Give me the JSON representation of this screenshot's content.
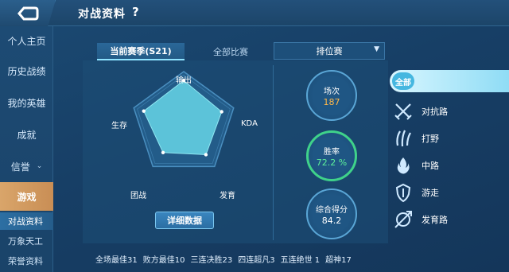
{
  "header": {
    "title": "对战资料",
    "help_glyph": "?"
  },
  "sidebar": {
    "items": [
      {
        "label": "个人主页"
      },
      {
        "label": "历史战绩"
      },
      {
        "label": "我的英雄"
      },
      {
        "label": "成就"
      },
      {
        "label": "信誉"
      },
      {
        "label": "游戏"
      }
    ],
    "sub_items": [
      {
        "label": "对战资料"
      },
      {
        "label": "万象天工"
      },
      {
        "label": "荣誉资料"
      }
    ]
  },
  "tabs": {
    "season": "当前赛季(S21)",
    "all": "全部比赛"
  },
  "mode_select": {
    "value": "排位赛"
  },
  "radar": {
    "axes": [
      "输出",
      "KDA",
      "发育",
      "团战",
      "生存"
    ],
    "values": [
      0.83,
      0.76,
      0.72,
      0.67,
      0.8
    ]
  },
  "detail_button": "详细数据",
  "stats": {
    "matches": {
      "label": "场次",
      "value": "187",
      "color": "#ffb84a"
    },
    "winrate": {
      "label": "胜率",
      "value": "72.2 %",
      "color": "#5df09a"
    },
    "score": {
      "label": "综合得分",
      "value": "84.2",
      "color": "#ffffff"
    }
  },
  "lanes": {
    "all_label": "全部",
    "items": [
      {
        "label": "对抗路",
        "icon": "crossed-swords-icon"
      },
      {
        "label": "打野",
        "icon": "claw-icon"
      },
      {
        "label": "中路",
        "icon": "mage-flame-icon"
      },
      {
        "label": "游走",
        "icon": "shield-wing-icon"
      },
      {
        "label": "发育路",
        "icon": "archer-icon"
      }
    ]
  },
  "footer": {
    "items": [
      "全场最佳31",
      "败方最佳10",
      "三连决胜23",
      "四连超凡3",
      "五连绝世 1",
      "超神17"
    ]
  }
}
